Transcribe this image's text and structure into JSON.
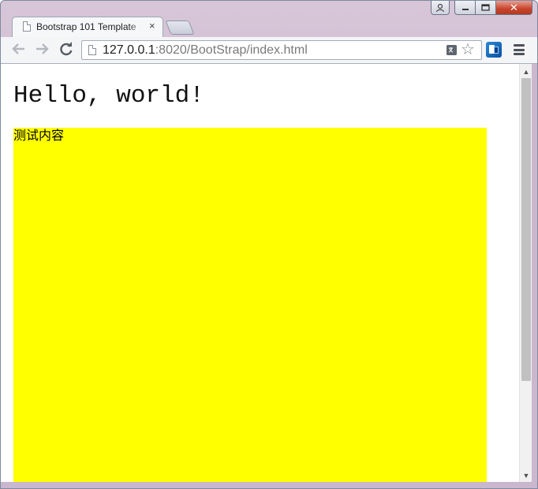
{
  "browser": {
    "tab": {
      "title": "Bootstrap 101 Template",
      "close_glyph": "×"
    },
    "toolbar": {
      "back_glyph": "⟵",
      "forward_glyph": "⟶",
      "reload_glyph": "⟳",
      "url_host": "127.0.0.1",
      "url_path": ":8020/BootStrap/index.html",
      "star_glyph": "☆"
    },
    "window_controls": {
      "user_glyph": "👤",
      "minimize_glyph": "▁",
      "maximize_glyph": "▭",
      "close_glyph": "✕"
    }
  },
  "page": {
    "heading": "Hello, world!",
    "box_text": "测试内容",
    "box_color": "#ffff00"
  },
  "scrollbar": {
    "up_glyph": "▲",
    "down_glyph": "▼"
  }
}
